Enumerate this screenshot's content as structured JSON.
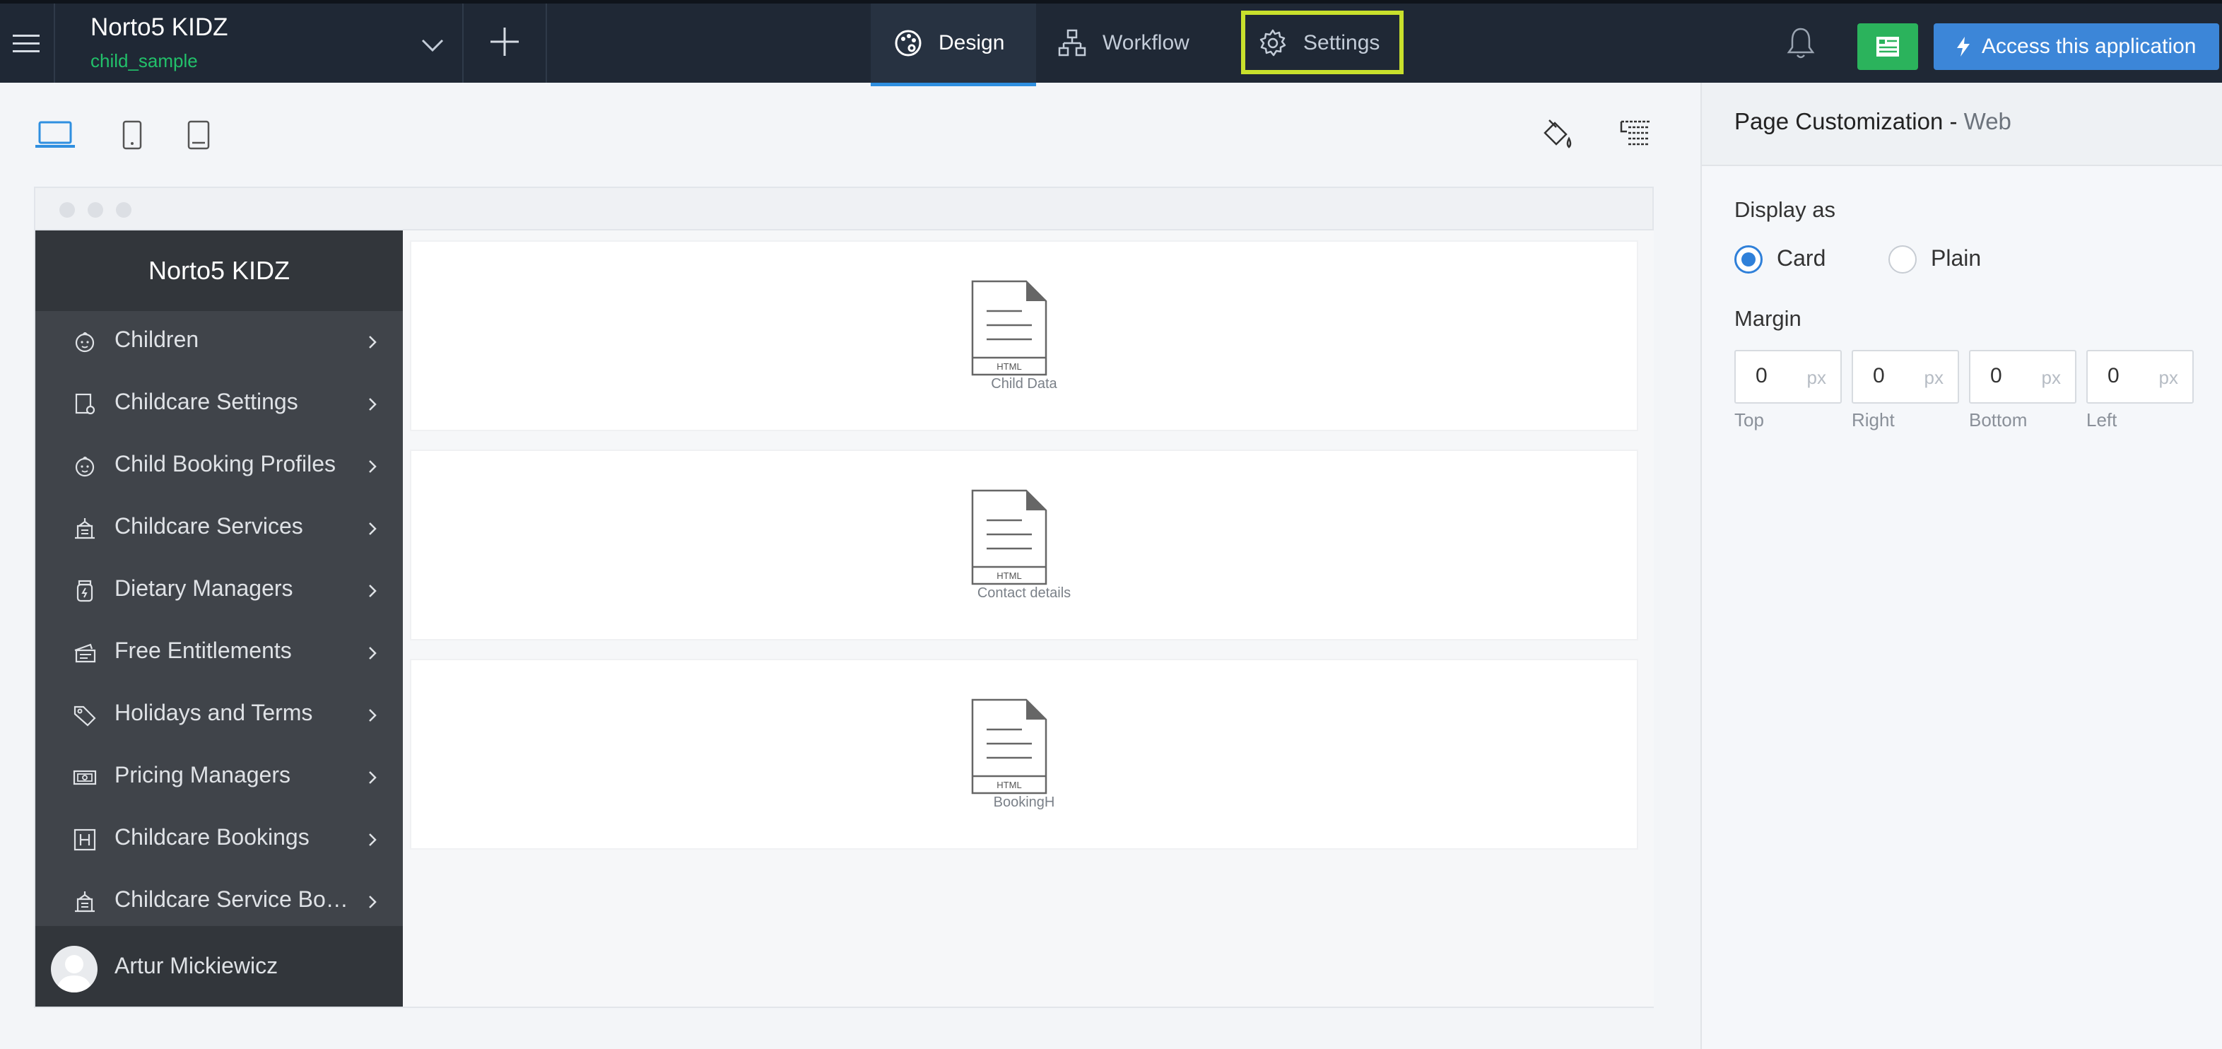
{
  "header": {
    "app_title": "Norto5 KIDZ",
    "app_subtitle": "child_sample",
    "tabs": [
      {
        "label": "Design",
        "icon": "palette-icon",
        "active": true
      },
      {
        "label": "Workflow",
        "icon": "workflow-icon",
        "active": false
      },
      {
        "label": "Settings",
        "icon": "gear-icon",
        "active": false,
        "highlighted": true
      }
    ],
    "access_button_label": "Access this application",
    "colors": {
      "topbar": "#1f2835",
      "accent_blue": "#3c86d8",
      "accent_green": "#2bb35c",
      "subtitle_green": "#22c06a",
      "highlight": "#c8e02c"
    }
  },
  "device_toolbar": {
    "devices": [
      "laptop-icon",
      "tablet-icon",
      "tablet-landscape-icon"
    ],
    "active_device": "laptop-icon",
    "tools": [
      "paint-bucket-icon",
      "layout-settings-icon"
    ]
  },
  "preview": {
    "sidebar_title": "Norto5 KIDZ",
    "menu": [
      {
        "label": "Children",
        "icon": "child-face-icon"
      },
      {
        "label": "Childcare Settings",
        "icon": "settings-doc-icon"
      },
      {
        "label": "Child Booking Profiles",
        "icon": "child-face-icon"
      },
      {
        "label": "Childcare Services",
        "icon": "building-icon"
      },
      {
        "label": "Dietary Managers",
        "icon": "jar-icon"
      },
      {
        "label": "Free Entitlements",
        "icon": "ticket-icon"
      },
      {
        "label": "Holidays and Terms",
        "icon": "tag-icon"
      },
      {
        "label": "Pricing Managers",
        "icon": "money-icon"
      },
      {
        "label": "Childcare Bookings",
        "icon": "letter-h-icon"
      },
      {
        "label": "Childcare Service Boo...",
        "icon": "building-icon"
      }
    ],
    "user_name": "Artur Mickiewicz",
    "cards": [
      {
        "icon_text": "HTML",
        "label": "Child Data"
      },
      {
        "icon_text": "HTML",
        "label": "Contact details"
      },
      {
        "icon_text": "HTML",
        "label": "BookingH"
      }
    ]
  },
  "panel": {
    "title": "Page Customization - ",
    "title_sub": "Web",
    "display_as_label": "Display as",
    "display_options": [
      {
        "label": "Card",
        "selected": true
      },
      {
        "label": "Plain",
        "selected": false
      }
    ],
    "margin_label": "Margin",
    "margins": [
      {
        "value": "0",
        "unit": "px",
        "label": "Top"
      },
      {
        "value": "0",
        "unit": "px",
        "label": "Right"
      },
      {
        "value": "0",
        "unit": "px",
        "label": "Bottom"
      },
      {
        "value": "0",
        "unit": "px",
        "label": "Left"
      }
    ]
  }
}
